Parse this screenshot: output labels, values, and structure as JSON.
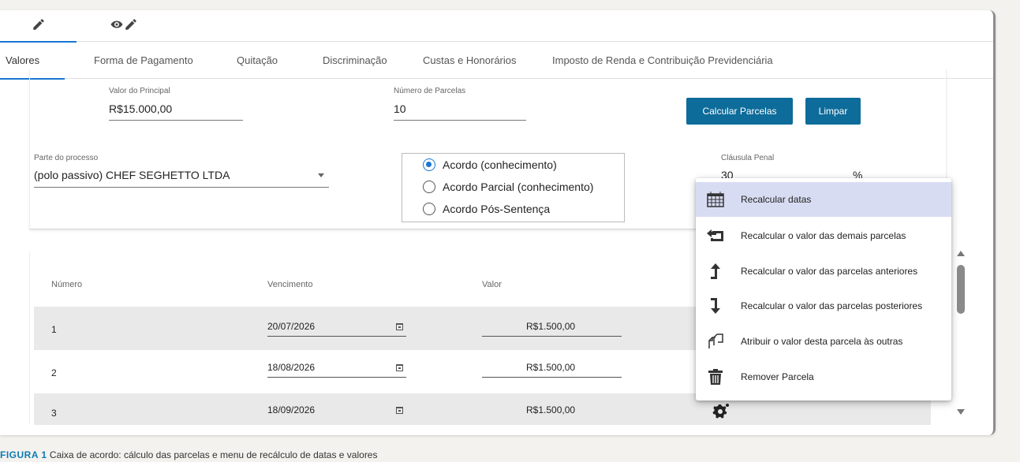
{
  "mode_tabs": [
    {
      "name": "edit-icon"
    },
    {
      "name": "view-edit-icon"
    }
  ],
  "tabs": [
    {
      "label": "Valores",
      "active": true
    },
    {
      "label": "Forma de Pagamento"
    },
    {
      "label": "Quitação"
    },
    {
      "label": "Discriminação"
    },
    {
      "label": "Custas e Honorários"
    },
    {
      "label": "Imposto de Renda e Contribuição Previdenciária"
    }
  ],
  "form": {
    "principal": {
      "label": "Valor do Principal",
      "value": "R$15.000,00"
    },
    "parcelas": {
      "label": "Número de Parcelas",
      "value": "10"
    },
    "calcular_label": "Calcular Parcelas",
    "limpar_label": "Limpar",
    "parte": {
      "label": "Parte do processo",
      "value": "(polo passivo) CHEF SEGHETTO LTDA"
    },
    "radios": [
      {
        "label": "Acordo (conhecimento)",
        "checked": true
      },
      {
        "label": "Acordo Parcial (conhecimento)",
        "checked": false
      },
      {
        "label": "Acordo Pós-Sentença",
        "checked": false
      }
    ],
    "clausula": {
      "label": "Cláusula Penal",
      "value": "30",
      "unit": "%"
    }
  },
  "table": {
    "headers": [
      "Número",
      "Vencimento",
      "Valor"
    ],
    "rows": [
      {
        "numero": "1",
        "vencimento": "20/07/2026",
        "valor": "R$1.500,00"
      },
      {
        "numero": "2",
        "vencimento": "18/08/2026",
        "valor": "R$1.500,00"
      },
      {
        "numero": "3",
        "vencimento": "18/09/2026",
        "valor": "R$1.500,00"
      }
    ]
  },
  "menu": {
    "items": [
      {
        "label": "Recalcular datas",
        "icon": "calendar-icon"
      },
      {
        "label": "Recalcular o valor das demais parcelas",
        "icon": "recalc-others-icon"
      },
      {
        "label": "Recalcular o valor das parcelas anteriores",
        "icon": "arrow-up-icon"
      },
      {
        "label": "Recalcular o valor das parcelas posteriores",
        "icon": "arrow-down-icon"
      },
      {
        "label": "Atribuir o valor desta parcela às outras",
        "icon": "copy-icon"
      },
      {
        "label": "Remover Parcela",
        "icon": "trash-icon"
      }
    ]
  },
  "caption": {
    "prefix": "FIGURA 1",
    "text": "Caixa de acordo: cálculo das parcelas e menu de recálculo de datas e valores"
  },
  "colors": {
    "accent": "#1976d2",
    "button": "#0d6c9a",
    "menu_highlight": "#d8dcf3",
    "row_shade": "#e9e9e9",
    "caption": "#0b7bb5"
  }
}
